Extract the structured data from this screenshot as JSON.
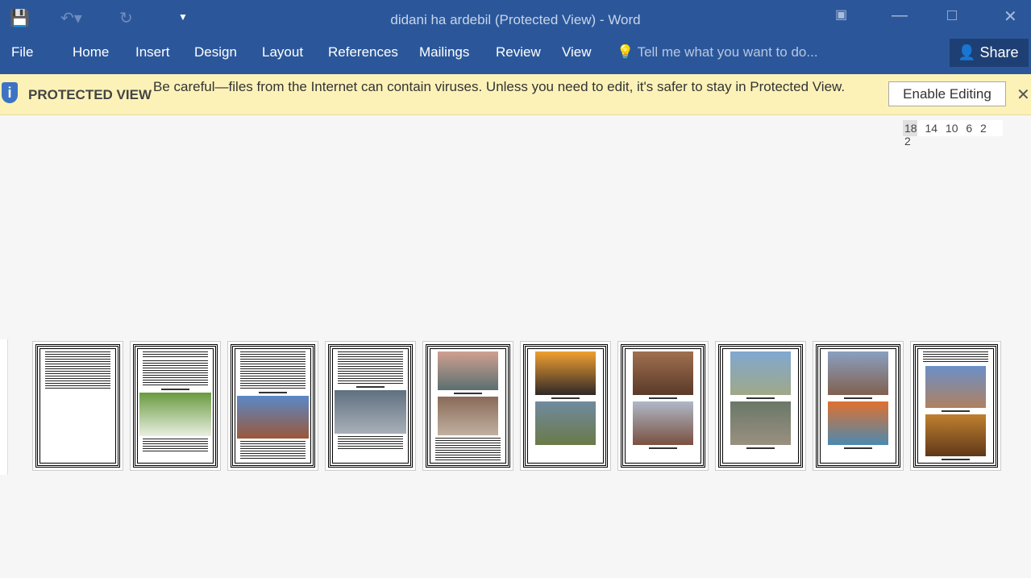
{
  "window": {
    "title": "didani ha ardebil (Protected View) - Word"
  },
  "qat": {
    "save_icon": "save-icon",
    "undo_icon": "undo-icon",
    "redo_icon": "redo-icon",
    "customize_icon": "customize-icon"
  },
  "ribbon": {
    "tabs": [
      "File",
      "Home",
      "Insert",
      "Design",
      "Layout",
      "References",
      "Mailings",
      "Review",
      "View"
    ],
    "tell_me": "Tell me what you want to do...",
    "share": "Share"
  },
  "protected_view": {
    "label": "PROTECTED VIEW",
    "message": "Be careful—files from the Internet can contain viruses. Unless you need to edit, it's safer to stay in Protected View.",
    "enable_button": "Enable Editing"
  },
  "ruler": {
    "labels": "18 14 10 6 2 2"
  },
  "pages": [
    {
      "layout": [
        "t6"
      ]
    },
    {
      "layout": [
        "t1",
        "t4",
        "l",
        "img:#6a9a40,#e8efe0",
        "t2"
      ]
    },
    {
      "layout": [
        "t6",
        "l",
        "img:#5a88c8,#9a5838",
        "t3"
      ]
    },
    {
      "layout": [
        "t5",
        "l",
        "img:#607080,#a8b0b8",
        "t2"
      ]
    },
    {
      "layout": [
        "img:#d0a090,#5a7070",
        "l",
        "img:#8a6a58,#c0b0a0",
        "t4"
      ]
    },
    {
      "layout": [
        "img:#f0a030,#302828",
        "l",
        "img:#708aa0,#6a7a48"
      ]
    },
    {
      "layout": [
        "img:#a07050,#5a3a28",
        "l",
        "img:#b0b8c8,#7a5040",
        "l"
      ]
    },
    {
      "layout": [
        "img:#80a8d0,#a0a888",
        "l",
        "img:#6a7868,#9a9080",
        "l"
      ]
    },
    {
      "layout": [
        "img:#8aa0c0,#806050",
        "l",
        "img:#e07030,#4a8ab0",
        "l"
      ]
    },
    {
      "layout": [
        "t2",
        "img:#6a90c8,#b08060",
        "l",
        "img:#c08030,#603818",
        "l"
      ]
    }
  ]
}
